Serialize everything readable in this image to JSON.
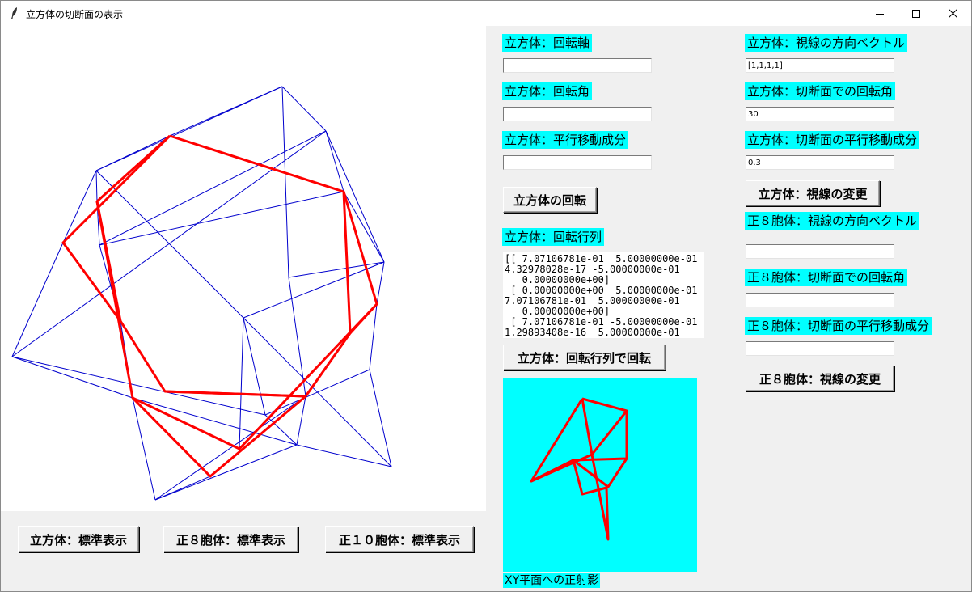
{
  "window": {
    "title": "立方体の切断面の表示",
    "minimize_icon": "minimize-icon",
    "maximize_icon": "maximize-icon",
    "close_icon": "close-icon"
  },
  "left_panel": {
    "rotation_axis_label": "立方体：回転軸",
    "rotation_axis_value": "",
    "rotation_angle_label": "立方体：回転角",
    "rotation_angle_value": "",
    "translation_label": "立方体：平行移動成分",
    "translation_value": "",
    "rotate_button": "立方体の回転",
    "rotation_matrix_label": "立方体：回転行列",
    "rotation_matrix_text": "[[ 7.07106781e-01  5.00000000e-01\n4.32978028e-17 -5.00000000e-01\n   0.00000000e+00]\n [ 0.00000000e+00  5.00000000e-01\n7.07106781e-01  5.00000000e-01\n   0.00000000e+00]\n [ 7.07106781e-01 -5.00000000e-01 -\n1.29893408e-16  5.00000000e-01",
    "rotate_by_matrix_button": "立方体：回転行列で回転"
  },
  "right_panel": {
    "cube_view_dir_label": "立方体：視線の方向ベクトル",
    "cube_view_dir_value": "[1,1,1,1]",
    "cube_section_angle_label": "立方体：切断面での回転角",
    "cube_section_angle_value": "30",
    "cube_section_translation_label": "立方体：切断面の平行移動成分",
    "cube_section_translation_value": "0.3",
    "cube_change_view_button": "立方体：視線の変更",
    "oct_view_dir_label": "正８胞体：視線の方向ベクトル",
    "oct_view_dir_value": "",
    "oct_section_angle_label": "正８胞体：切断面での回転角",
    "oct_section_angle_value": "",
    "oct_section_translation_label": "正８胞体：切断面の平行移動成分",
    "oct_section_translation_value": "",
    "oct_change_view_button": "正８胞体：視線の変更"
  },
  "projection": {
    "caption": "XY平面への正射影",
    "background": "#00ffff",
    "stroke": "#ff0000"
  },
  "bottom_buttons": {
    "cube_standard": "立方体：標準表示",
    "oct_standard": "正８胞体：標準表示",
    "deca_standard": "正１０胞体：標準表示"
  },
  "colors": {
    "wireframe": "#0000cd",
    "section": "#ff0000",
    "label_bg": "#00ffff"
  }
}
